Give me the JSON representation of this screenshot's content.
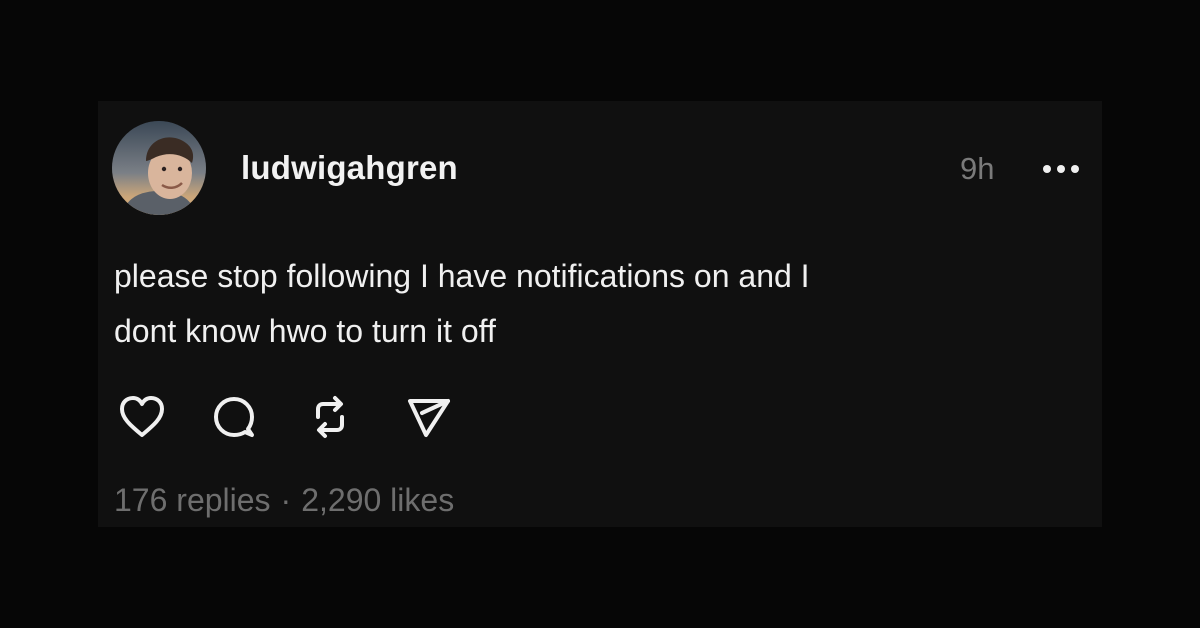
{
  "post": {
    "username": "ludwigahgren",
    "timestamp": "9h",
    "text_line1": "please stop following I have notifications on and I",
    "text_line2": "dont know hwo to turn it off",
    "replies": "176 replies",
    "separator": "·",
    "likes": "2,290 likes"
  },
  "icons": {
    "like": "heart-icon",
    "reply": "comment-icon",
    "repost": "repost-icon",
    "share": "send-icon",
    "more": "more-icon"
  },
  "colors": {
    "background": "#060606",
    "card": "#101010",
    "text": "#f0f0f0",
    "muted": "#6e6e6e"
  }
}
